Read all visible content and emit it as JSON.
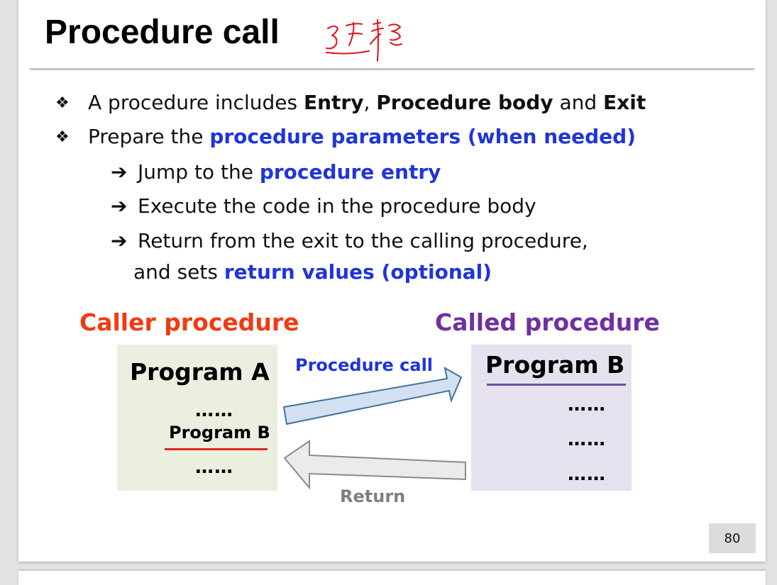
{
  "slide": {
    "title": "Procedure call",
    "handwritten_note": "过程",
    "page_number": "80"
  },
  "bullets": [
    {
      "glyph": "❖",
      "parts": [
        {
          "text": "A procedure includes ",
          "style": "normal"
        },
        {
          "text": "Entry",
          "style": "bold"
        },
        {
          "text": ", ",
          "style": "normal"
        },
        {
          "text": "Procedure body",
          "style": "bold"
        },
        {
          "text": " and ",
          "style": "normal"
        },
        {
          "text": "Exit",
          "style": "bold"
        }
      ]
    },
    {
      "glyph": "❖",
      "parts": [
        {
          "text": "Prepare the ",
          "style": "normal"
        },
        {
          "text": "procedure parameters (when needed)",
          "style": "blue"
        }
      ]
    }
  ],
  "steps": [
    {
      "glyph": "➔",
      "parts": [
        {
          "text": "Jump to the ",
          "style": "normal"
        },
        {
          "text": "procedure entry",
          "style": "blue"
        }
      ]
    },
    {
      "glyph": "➔",
      "parts": [
        {
          "text": "Execute the code in the procedure body",
          "style": "normal"
        }
      ]
    },
    {
      "glyph": "➔",
      "parts": [
        {
          "text": "Return from the exit to the calling procedure,",
          "style": "normal"
        }
      ]
    }
  ],
  "step_continuation": {
    "parts": [
      {
        "text": "and sets ",
        "style": "normal"
      },
      {
        "text": "return values (optional)",
        "style": "blue"
      }
    ]
  },
  "diagram": {
    "caller_label": "Caller procedure",
    "called_label": "Called procedure",
    "program_a": {
      "title": "Program A",
      "dots_top": "……",
      "call_line": "Program B",
      "dots_bottom": "……"
    },
    "program_b": {
      "title": "Program B",
      "dots": [
        "……",
        "……",
        "……"
      ]
    },
    "call_arrow_label": "Procedure call",
    "return_arrow_label": "Return"
  },
  "colors": {
    "blue_emphasis": "#1f35d8",
    "caller_red": "#f03b12",
    "called_purple": "#7030a0",
    "program_a_bg": "#ebefe0",
    "program_b_bg": "#e6e1ee",
    "return_gray": "#7f7f7f",
    "handwriting_red": "#e0101a"
  }
}
